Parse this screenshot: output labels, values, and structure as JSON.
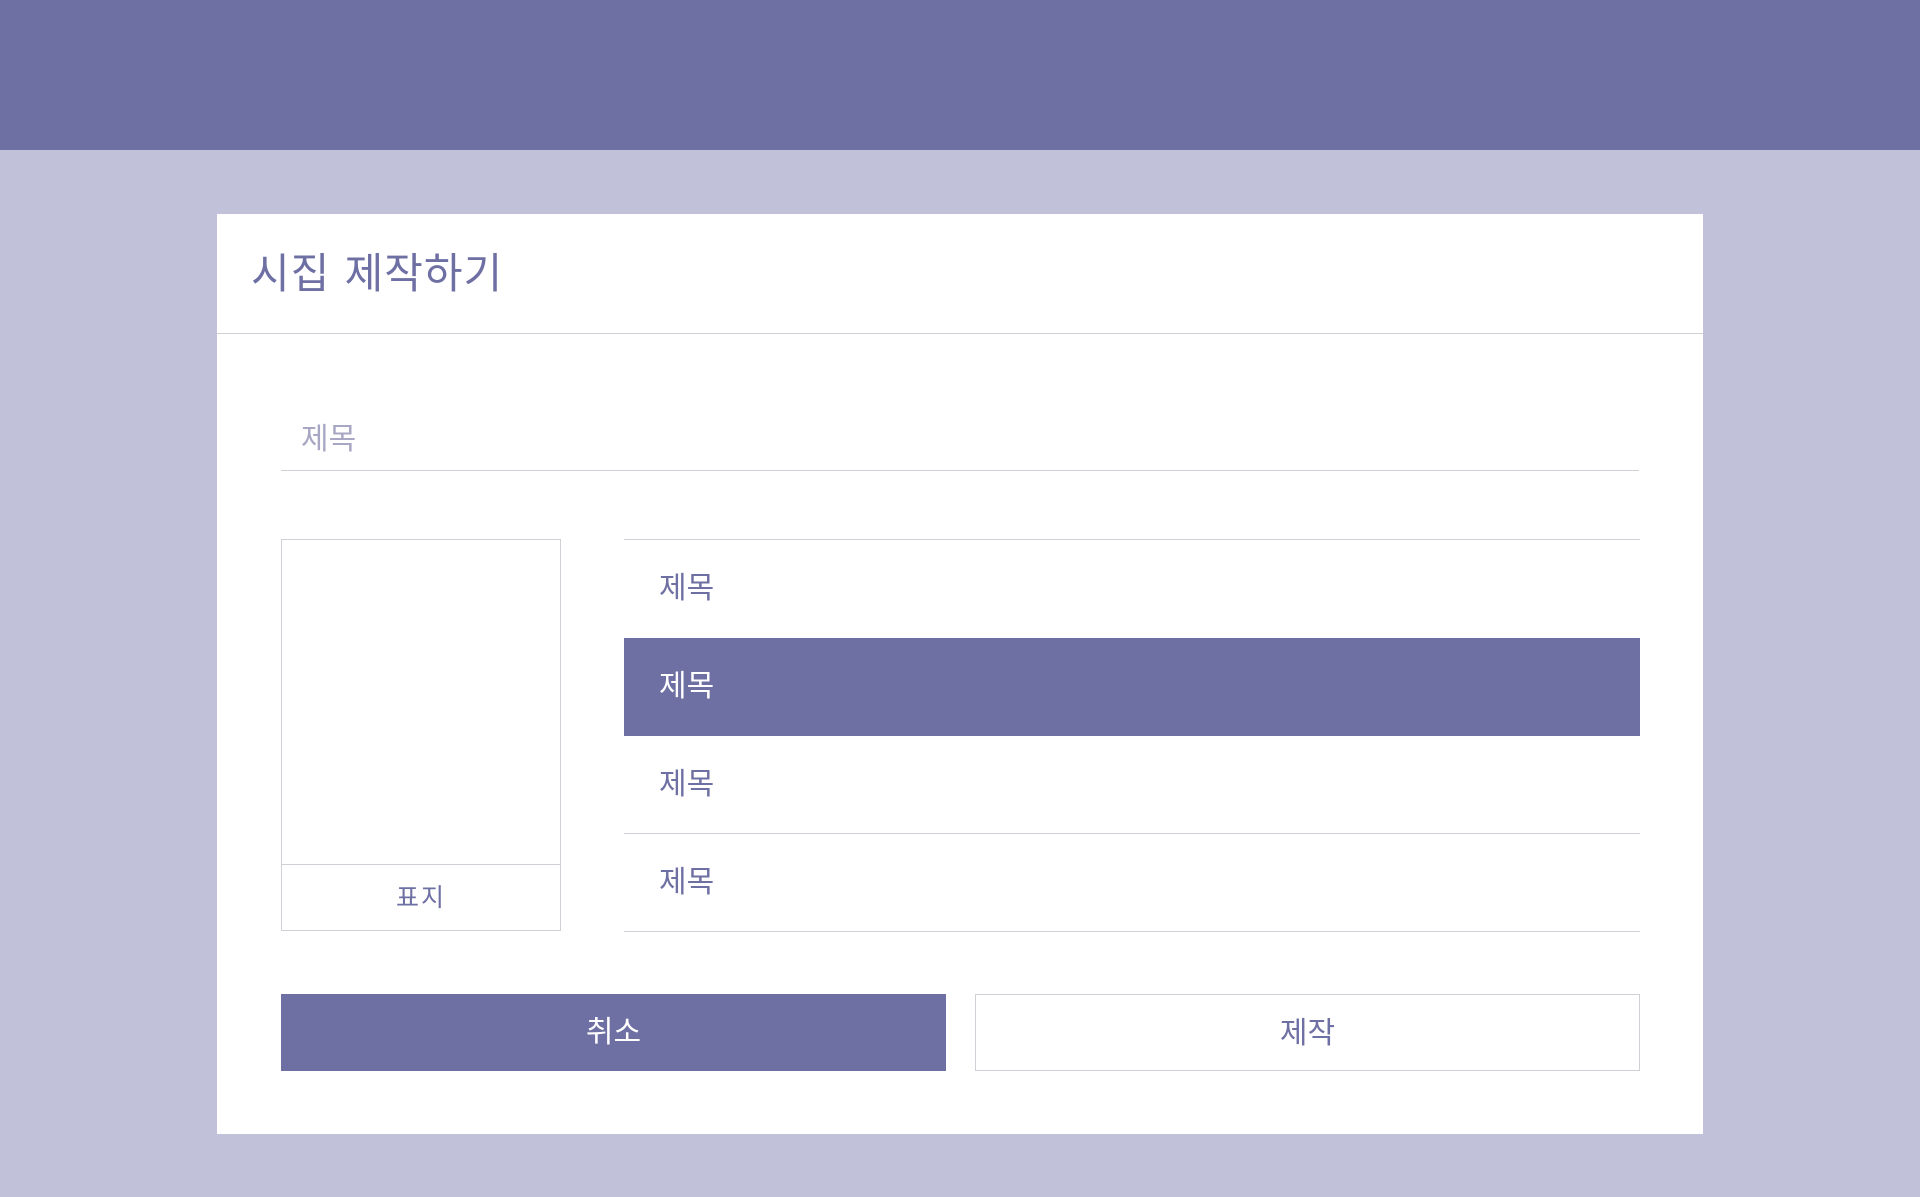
{
  "dialog": {
    "title": "시집 제작하기"
  },
  "title_input": {
    "placeholder": "제목",
    "value": ""
  },
  "cover": {
    "label": "표지"
  },
  "poem_list": {
    "items": [
      {
        "label": "제목",
        "selected": false
      },
      {
        "label": "제목",
        "selected": true
      },
      {
        "label": "제목",
        "selected": false
      },
      {
        "label": "제목",
        "selected": false
      }
    ]
  },
  "buttons": {
    "cancel_label": "취소",
    "create_label": "제작"
  },
  "colors": {
    "accent": "#6e6fa3",
    "background": "#c1c1da",
    "surface": "#ffffff",
    "divider": "#cfcfd6"
  }
}
